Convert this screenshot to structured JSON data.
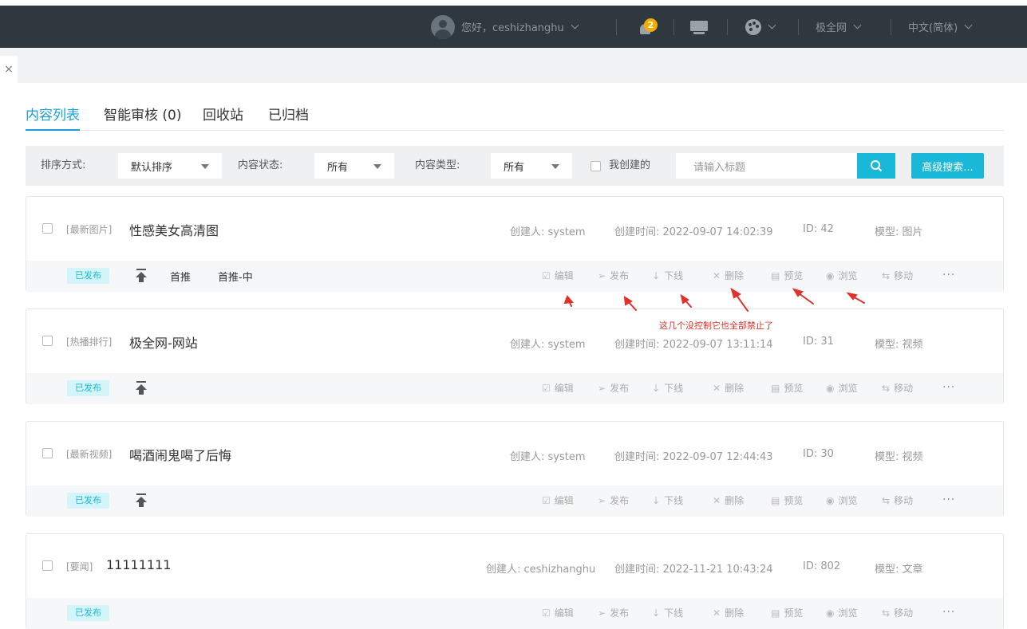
{
  "header": {
    "greeting": "您好，ceshizhanghu",
    "notification_count": "2",
    "site_selector": "极全网",
    "language_selector": "中文(简体)"
  },
  "tab_close": "×",
  "subtabs": [
    {
      "label": "内容列表",
      "active": true
    },
    {
      "label": "智能审核 (0)",
      "active": false
    },
    {
      "label": "回收站",
      "active": false
    },
    {
      "label": "已归档",
      "active": false
    }
  ],
  "filters": {
    "sort_label": "排序方式:",
    "sort_value": "默认排序",
    "status_label": "内容状态:",
    "status_value": "所有",
    "type_label": "内容类型:",
    "type_value": "所有",
    "mine_label": "我创建的",
    "search_placeholder": "请输入标题",
    "advanced_search": "高级搜索..."
  },
  "items": [
    {
      "category": "[最新图片]",
      "title": "性感美女高清图",
      "creator": "创建人: system",
      "created": "创建时间: 2022-09-07 14:02:39",
      "id": "ID: 42",
      "model": "模型: 图片",
      "status": "已发布",
      "recommend": [
        "首推",
        "首推-中"
      ]
    },
    {
      "category": "[热播排行]",
      "title": "极全网-网站",
      "creator": "创建人: system",
      "created": "创建时间: 2022-09-07 13:11:14",
      "id": "ID: 31",
      "model": "模型: 视频",
      "status": "已发布",
      "recommend": []
    },
    {
      "category": "[最新视频]",
      "title": "喝酒闹鬼喝了后悔",
      "creator": "创建人: system",
      "created": "创建时间: 2022-09-07 12:44:43",
      "id": "ID: 30",
      "model": "模型: 视频",
      "status": "已发布",
      "recommend": []
    },
    {
      "category": "[要闻]",
      "title": "11111111",
      "creator": "创建人: ceshizhanghu",
      "created": "创建时间: 2022-11-21 10:43:24",
      "id": "ID: 802",
      "model": "模型: 文章",
      "status": "已发布",
      "recommend": []
    }
  ],
  "actions": [
    {
      "label": "编辑",
      "icon": "edit-icon"
    },
    {
      "label": "发布",
      "icon": "send-icon"
    },
    {
      "label": "下线",
      "icon": "arrow-down-icon"
    },
    {
      "label": "删除",
      "icon": "close-icon"
    },
    {
      "label": "预览",
      "icon": "file-icon"
    },
    {
      "label": "浏览",
      "icon": "eye-icon"
    },
    {
      "label": "移动",
      "icon": "swap-icon"
    }
  ],
  "more_label": "···",
  "annotation": "这几个没控制它也全部禁止了",
  "colors": {
    "accent": "#1ab8d8",
    "topbar": "#30383f",
    "annotation": "#e0322a"
  }
}
